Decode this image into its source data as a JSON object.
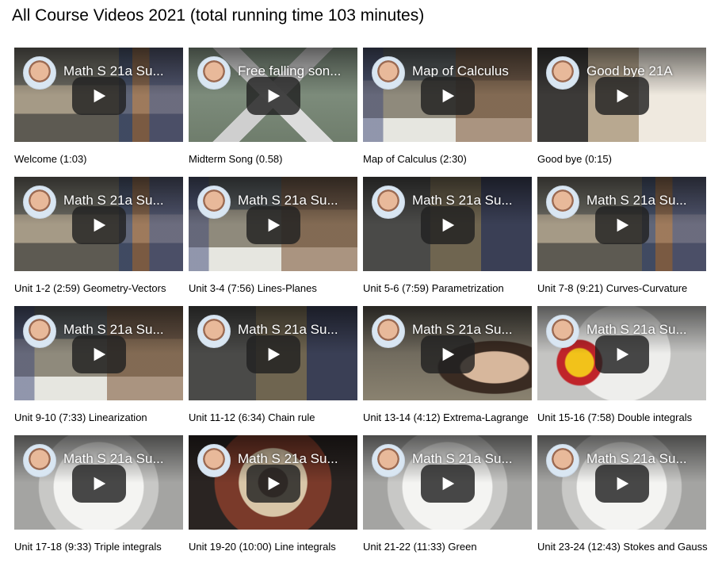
{
  "page": {
    "title": "All Course Videos 2021 (total running time 103 minutes)"
  },
  "videos": [
    {
      "video_title": "Math S 21a Su...",
      "caption": "Welcome (1:03)",
      "thumb": "bg-lab"
    },
    {
      "video_title": "Free falling son...",
      "caption": "Midterm Song (0.58)",
      "thumb": "bg-aerial"
    },
    {
      "video_title": "Map of Calculus",
      "caption": "Map of Calculus (2:30)",
      "thumb": "bg-lab2"
    },
    {
      "video_title": "Good bye 21A",
      "caption": "Good bye (0:15)",
      "thumb": "bg-piano"
    },
    {
      "video_title": "Math S 21a Su...",
      "caption": "Unit 1-2 (2:59) Geometry-Vectors",
      "thumb": "bg-lab"
    },
    {
      "video_title": "Math S 21a Su...",
      "caption": "Unit 3-4 (7:56) Lines-Planes",
      "thumb": "bg-lab2"
    },
    {
      "video_title": "Math S 21a Su...",
      "caption": "Unit 5-6 (7:59) Parametrization",
      "thumb": "bg-dark"
    },
    {
      "video_title": "Math S 21a Su...",
      "caption": "Unit 7-8 (9:21) Curves-Curvature",
      "thumb": "bg-lab"
    },
    {
      "video_title": "Math S 21a Su...",
      "caption": "Unit 9-10 (7:33) Linearization",
      "thumb": "bg-lab2"
    },
    {
      "video_title": "Math S 21a Su...",
      "caption": "Unit 11-12 (6:34) Chain rule",
      "thumb": "bg-dark"
    },
    {
      "video_title": "Math S 21a Su...",
      "caption": "Unit 13-14 (4:12) Extrema-Lagrange",
      "thumb": "bg-portrait"
    },
    {
      "video_title": "Math S 21a Su...",
      "caption": "Unit 15-16 (7:58) Double integrals",
      "thumb": "bg-robot"
    },
    {
      "video_title": "Math S 21a Su...",
      "caption": "Unit 17-18 (9:33) Triple integrals",
      "thumb": "bg-bright"
    },
    {
      "video_title": "Math S 21a Su...",
      "caption": "Unit 19-20 (10:00) Line integrals",
      "thumb": "bg-fisheye"
    },
    {
      "video_title": "Math S 21a Su...",
      "caption": "Unit 21-22 (11:33) Green",
      "thumb": "bg-bright"
    },
    {
      "video_title": "Math S 21a Su...",
      "caption": "Unit 23-24 (12:43) Stokes and Gauss",
      "thumb": "bg-bright"
    }
  ],
  "icons": {
    "play": "play-icon",
    "avatar": "channel-avatar"
  },
  "colors": {
    "play_button_bg": "#212121",
    "caption_text": "#000000"
  }
}
